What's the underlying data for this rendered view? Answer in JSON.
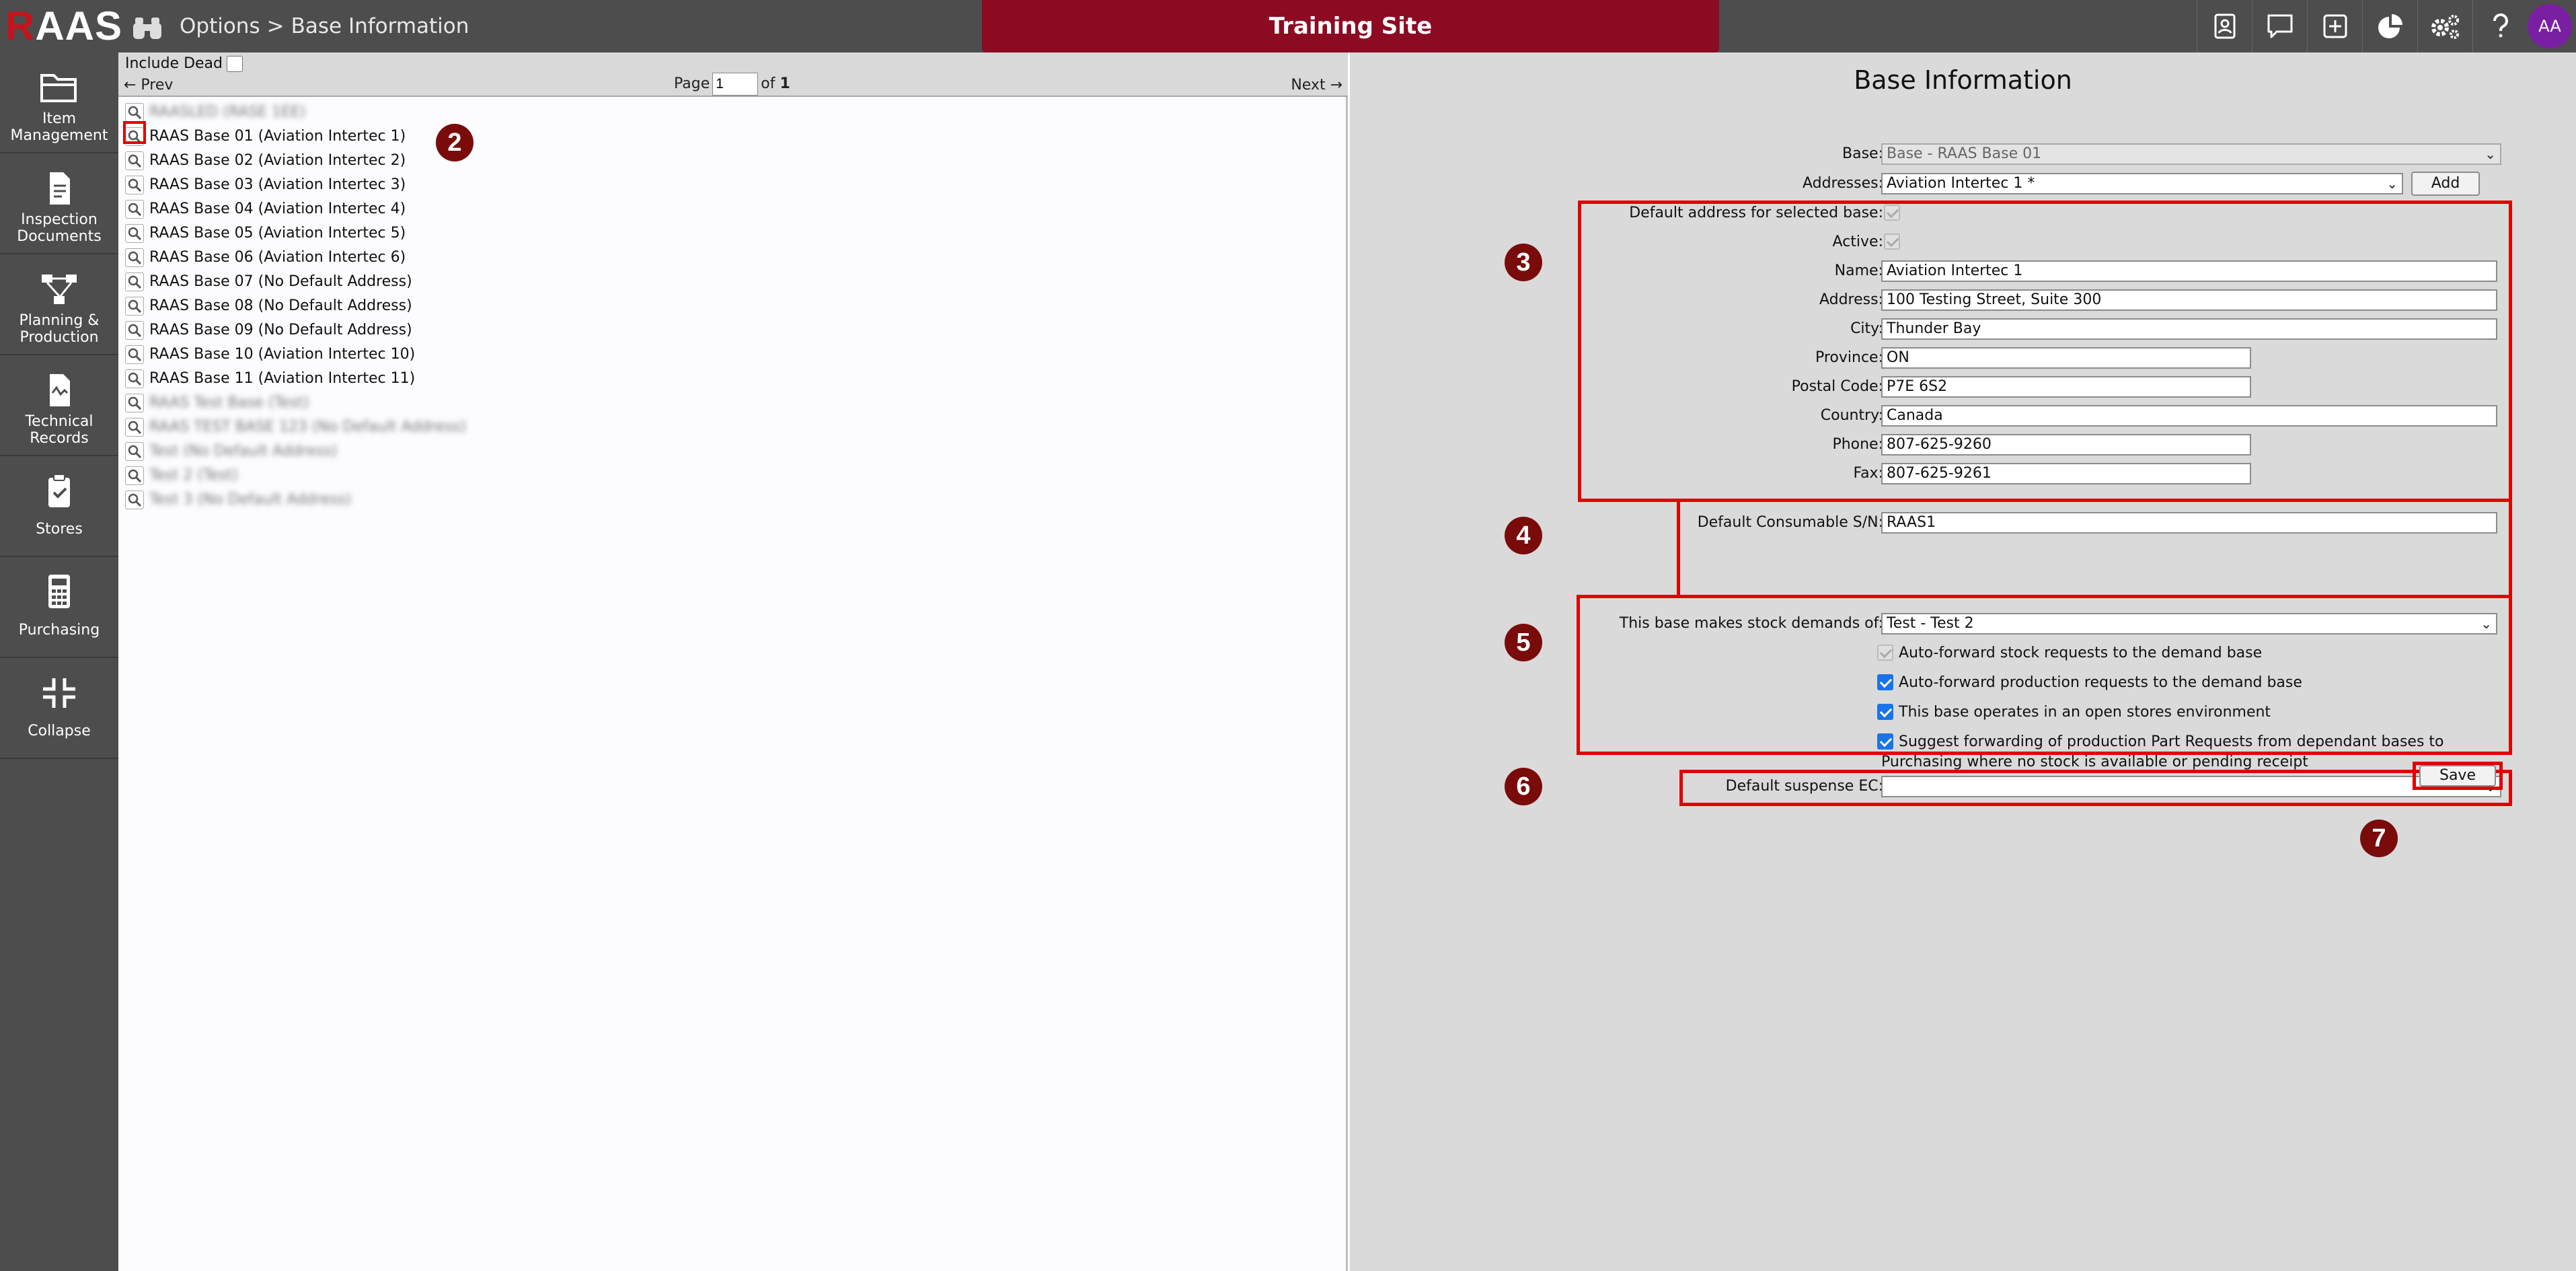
{
  "app": {
    "logo_prefix": "R",
    "logo_rest": "AAS"
  },
  "breadcrumb": {
    "root": "Options",
    "separator": ">",
    "current": "Base Information"
  },
  "site_banner": "Training Site",
  "user": {
    "initials": "AA"
  },
  "top_icons": [
    "contacts-icon",
    "chat-icon",
    "add-icon",
    "chart-icon",
    "settings-icon",
    "help-icon"
  ],
  "sidebar": {
    "items": [
      {
        "label_l1": "Item",
        "label_l2": "Management",
        "icon": "folder-icon"
      },
      {
        "label_l1": "Inspection",
        "label_l2": "Documents",
        "icon": "document-icon"
      },
      {
        "label_l1": "Planning &",
        "label_l2": "Production",
        "icon": "workflow-icon"
      },
      {
        "label_l1": "Technical",
        "label_l2": "Records",
        "icon": "records-icon"
      },
      {
        "label_l1": "Stores",
        "label_l2": "",
        "icon": "clipboard-check-icon"
      },
      {
        "label_l1": "Purchasing",
        "label_l2": "",
        "icon": "calculator-icon"
      },
      {
        "label_l1": "Collapse",
        "label_l2": "",
        "icon": "collapse-icon"
      }
    ]
  },
  "list": {
    "include_dead_label": "Include Dead",
    "prev_label": "← Prev",
    "next_label": "Next →",
    "page_label": "Page",
    "page_value": "1",
    "of_label": "of",
    "total_pages": "1",
    "rows": [
      "RAASLED (RASE 1EE)",
      "RAAS Base 01 (Aviation Intertec 1)",
      "RAAS Base 02 (Aviation Intertec 2)",
      "RAAS Base 03 (Aviation Intertec 3)",
      "RAAS Base 04 (Aviation Intertec 4)",
      "RAAS Base 05 (Aviation Intertec 5)",
      "RAAS Base 06 (Aviation Intertec 6)",
      "RAAS Base 07 (No Default Address)",
      "RAAS Base 08 (No Default Address)",
      "RAAS Base 09 (No Default Address)",
      "RAAS Base 10 (Aviation Intertec 10)",
      "RAAS Base 11 (Aviation Intertec 11)",
      "RAAS Test Base (Test)",
      "RAAS TEST BASE 123 (No Default Address)",
      "Test (No Default Address)",
      "Test 2 (Test)",
      "Test 3 (No Default Address)"
    ]
  },
  "markers": [
    "2",
    "3",
    "4",
    "5",
    "6",
    "7"
  ],
  "form": {
    "title": "Base Information",
    "base_label": "Base:",
    "base_value": "Base - RAAS Base 01",
    "addresses_label": "Addresses:",
    "addresses_value": "Aviation Intertec 1 *",
    "add_button": "Add",
    "default_address_label": "Default address for selected base:",
    "active_label": "Active:",
    "name_label": "Name:",
    "name_value": "Aviation Intertec 1",
    "address_label": "Address:",
    "address_value": "100 Testing Street, Suite 300",
    "city_label": "City:",
    "city_value": "Thunder Bay",
    "province_label": "Province:",
    "province_value": "ON",
    "postal_label": "Postal Code:",
    "postal_value": "P7E 6S2",
    "country_label": "Country:",
    "country_value": "Canada",
    "phone_label": "Phone:",
    "phone_value": "807-625-9260",
    "fax_label": "Fax:",
    "fax_value": "807-625-9261",
    "consumable_label": "Default Consumable S/N:",
    "consumable_value": "RAAS1",
    "stock_demands_label": "This base makes stock demands of:",
    "stock_demands_value": "Test - Test 2",
    "cb_auto_forward_stock": "Auto-forward stock requests to the demand base",
    "cb_auto_forward_production": "Auto-forward production requests to the demand base",
    "cb_open_stores": "This base operates in an open stores environment",
    "cb_suggest_line1": "Suggest forwarding of production Part Requests from dependant bases to",
    "cb_suggest_line2": "Purchasing where no stock is available or pending receipt",
    "suspense_label": "Default suspense EC:",
    "suspense_value": "",
    "save_button": "Save"
  },
  "colors": {
    "accent": "#8c0a22",
    "highlight": "#e00000",
    "marker": "#7a0b0b",
    "avatar": "#7b1fa2"
  }
}
